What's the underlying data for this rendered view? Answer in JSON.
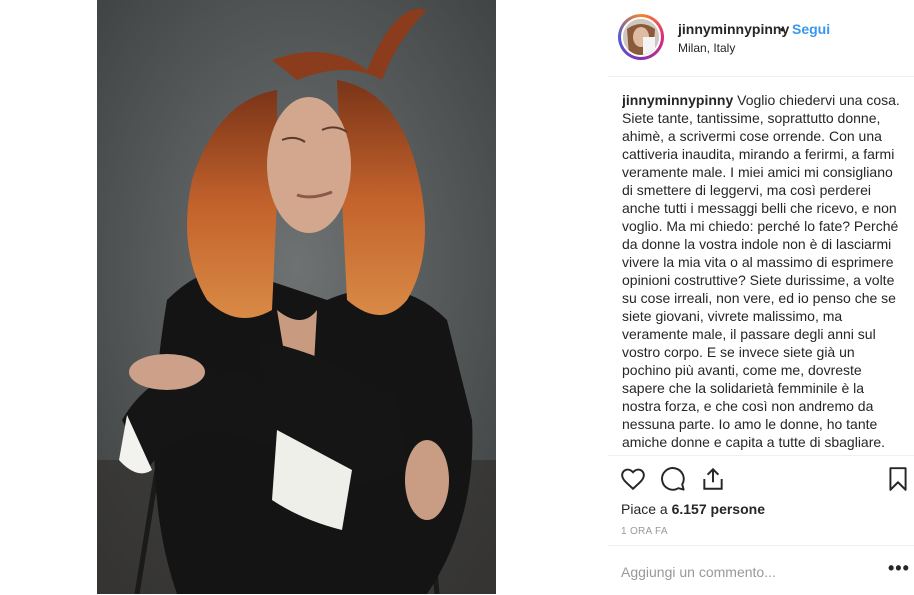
{
  "post": {
    "username": "jinnyminnypinny",
    "separator": "•",
    "follow_label": "Segui",
    "location": "Milan, Italy"
  },
  "caption": {
    "username": "jinnyminnypinny",
    "text": "Voglio chiedervi una cosa. Siete tante, tantissime, soprattutto donne, ahimè, a scrivermi cose orrende. Con una cattiveria inaudita, mirando a ferirmi, a farmi veramente male. I miei amici mi consigliano di smettere di leggervi, ma così perderei anche tutti i messaggi belli che ricevo, e non voglio. Ma mi chiedo: perché lo fate? Perché da donne la vostra indole non è di lasciarmi vivere la mia vita o al massimo di esprimere opinioni costruttive? Siete durissime, a volte su cose irreali, non vere, ed io penso che se siete giovani, vivrete malissimo, ma veramente male, il passare degli anni sul vostro corpo. E se invece siete già un pochino più avanti, come me, dovreste sapere che la solidarietà femminile è la nostra forza, e che così non andremo da nessuna parte. Io amo le donne, ho tante amiche donne e capita a tutte di sbagliare. Ma smettetela..."
  },
  "actions": {
    "icons": [
      "heart-icon",
      "comment-icon",
      "share-icon",
      "bookmark-icon"
    ]
  },
  "likes": {
    "prefix": "Piace a ",
    "count": "6.157 persone"
  },
  "timestamp": "1 ORA FA",
  "comment": {
    "placeholder": "Aggiungi un commento...",
    "more_label": "•••"
  },
  "colors": {
    "link_blue": "#3897f0",
    "text": "#262626",
    "muted": "#999999",
    "photo_backdrop": "#5f6262",
    "hair": "#b8552a"
  }
}
